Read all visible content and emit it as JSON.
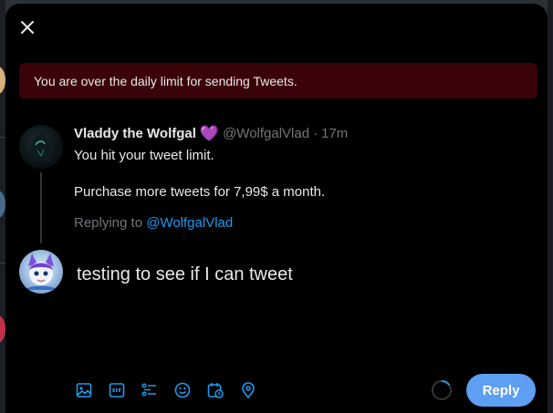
{
  "banner": {
    "text": "You are over the daily limit for sending Tweets."
  },
  "original_tweet": {
    "author_name": "Vladdy the Wolfgal",
    "author_badge": "💜",
    "handle": "@WolfgalVlad",
    "separator": "·",
    "time": "17m",
    "line1": "You hit your tweet limit.",
    "line2": "Purchase more tweets for 7,99$ a month.",
    "replying_prefix": "Replying to",
    "replying_handle": "@WolfgalVlad"
  },
  "compose": {
    "text": "testing to see if I can tweet"
  },
  "toolbar": {
    "icons": [
      "image-icon",
      "gif-icon",
      "poll-icon",
      "emoji-icon",
      "schedule-icon",
      "location-icon"
    ],
    "reply_label": "Reply"
  },
  "colors": {
    "accent": "#1d9bf0",
    "reply_button": "#5d9ff2",
    "banner_bg": "#3a0308",
    "muted": "#71767b"
  }
}
